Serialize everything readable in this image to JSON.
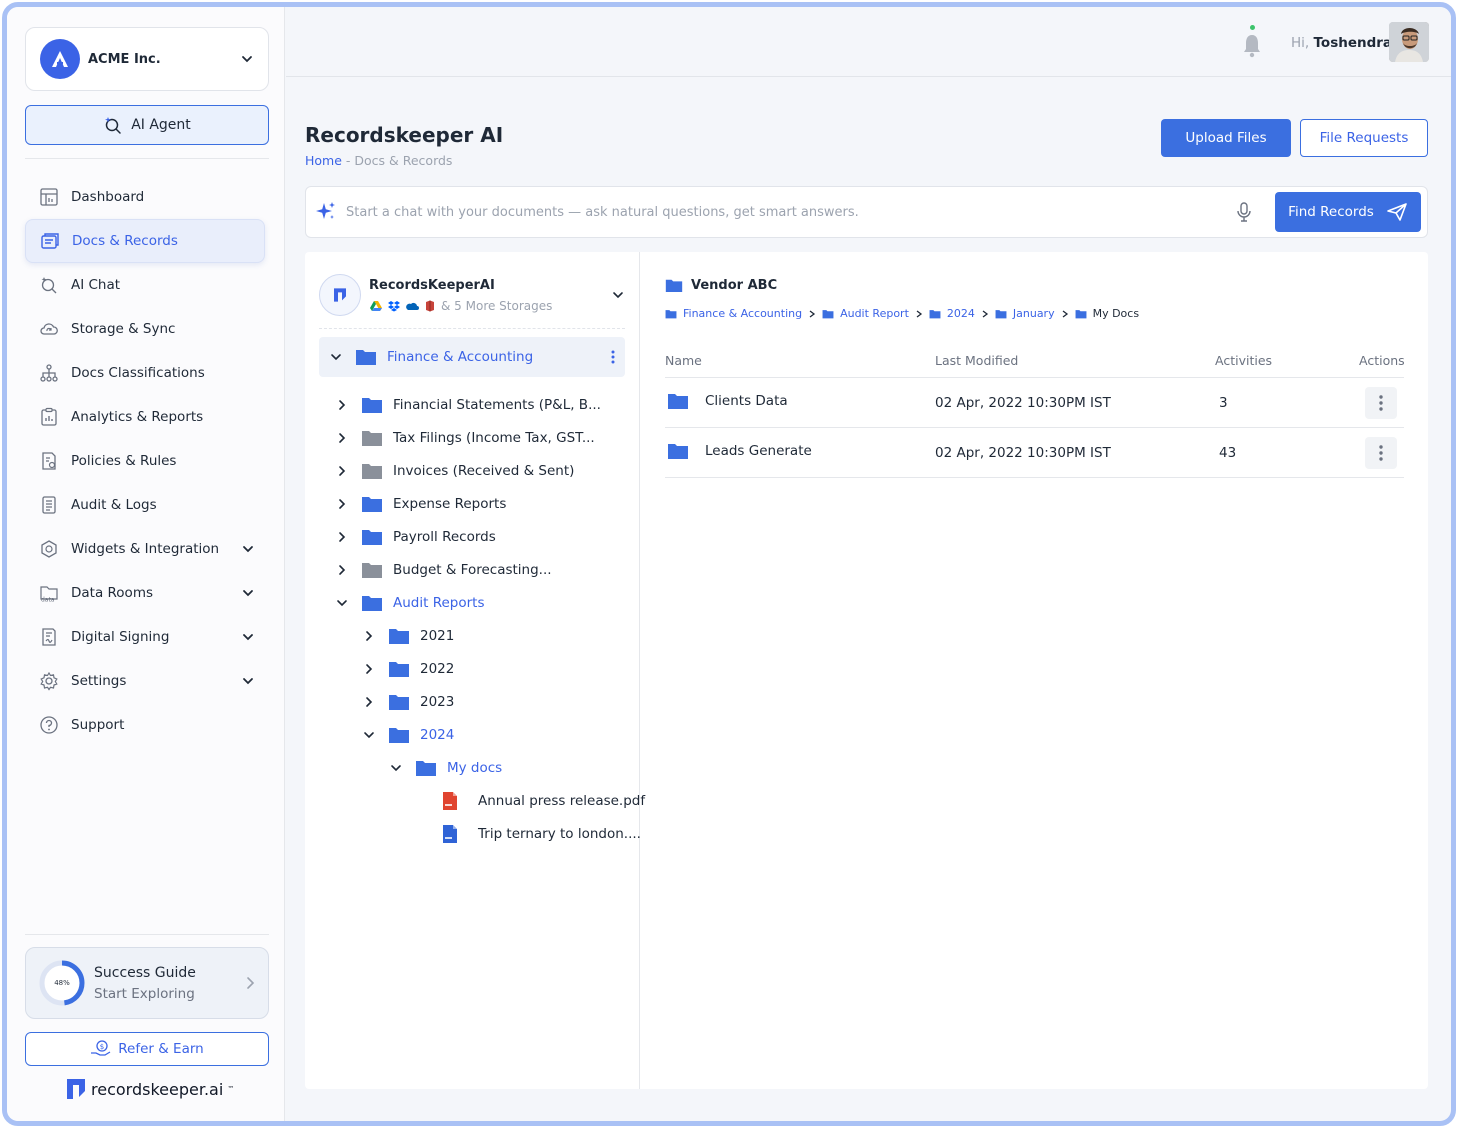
{
  "org": {
    "name": "ACME Inc.",
    "logo_letter": "A"
  },
  "ai_agent": {
    "label": "AI Agent"
  },
  "sidebar": {
    "items": [
      {
        "label": "Dashboard",
        "icon": "dashboard-icon",
        "expandable": false
      },
      {
        "label": "Docs & Records",
        "icon": "docs-icon",
        "expandable": false,
        "active": true
      },
      {
        "label": "AI Chat",
        "icon": "ai-chat-icon",
        "expandable": false
      },
      {
        "label": "Storage & Sync",
        "icon": "cloud-sync-icon",
        "expandable": false
      },
      {
        "label": "Docs Classifications",
        "icon": "hierarchy-icon",
        "expandable": false
      },
      {
        "label": "Analytics & Reports",
        "icon": "clipboard-chart-icon",
        "expandable": false
      },
      {
        "label": "Policies & Rules",
        "icon": "policy-icon",
        "expandable": false
      },
      {
        "label": "Audit & Logs",
        "icon": "log-icon",
        "expandable": false
      },
      {
        "label": "Widgets & Integration",
        "icon": "widgets-icon",
        "expandable": true
      },
      {
        "label": "Data Rooms",
        "icon": "data-folder-icon",
        "expandable": true
      },
      {
        "label": "Digital Signing",
        "icon": "signing-icon",
        "expandable": true
      },
      {
        "label": "Settings",
        "icon": "gear-icon",
        "expandable": true
      },
      {
        "label": "Support",
        "icon": "help-icon",
        "expandable": false
      }
    ]
  },
  "success_guide": {
    "title": "Success Guide",
    "subtitle": "Start Exploring",
    "progress_label": "48%",
    "progress": 0.48
  },
  "refer": {
    "label": "Refer & Earn"
  },
  "brand": {
    "name": "recordskeeper.ai",
    "mark": "™"
  },
  "topbar": {
    "greeting_prefix": "Hi,",
    "user_name": "Toshendra"
  },
  "page": {
    "title": "Recordskeeper AI",
    "breadcrumb_home": "Home",
    "breadcrumb_rest": " - Docs & Records",
    "upload_label": "Upload Files",
    "requests_label": "File Requests"
  },
  "chat": {
    "placeholder": "Start a chat with your documents — ask natural questions, get smart answers.",
    "find_label": "Find Records"
  },
  "storage": {
    "name": "RecordsKeeperAI",
    "more": "& 5 More Storages"
  },
  "tree": {
    "root": "Finance & Accounting",
    "rows": [
      {
        "label": "Financial Statements (P&L, B...",
        "level": 0,
        "state": "collapsed",
        "color": "#3b6fe0",
        "kind": "folder"
      },
      {
        "label": "Tax Filings (Income Tax, GST...",
        "level": 0,
        "state": "collapsed",
        "color": "#8a909a",
        "kind": "folder"
      },
      {
        "label": "Invoices (Received & Sent)",
        "level": 0,
        "state": "collapsed",
        "color": "#8a909a",
        "kind": "folder"
      },
      {
        "label": "Expense Reports",
        "level": 0,
        "state": "collapsed",
        "color": "#3b6fe0",
        "kind": "folder"
      },
      {
        "label": "Payroll Records",
        "level": 0,
        "state": "collapsed",
        "color": "#3b6fe0",
        "kind": "folder"
      },
      {
        "label": "Budget & Forecasting...",
        "level": 0,
        "state": "collapsed",
        "color": "#8a909a",
        "kind": "folder"
      },
      {
        "label": "Audit Reports",
        "level": 0,
        "state": "expanded",
        "color": "#3b6fe0",
        "kind": "folder",
        "selected": true
      },
      {
        "label": "2021",
        "level": 1,
        "state": "collapsed",
        "color": "#3b6fe0",
        "kind": "folder"
      },
      {
        "label": "2022",
        "level": 1,
        "state": "collapsed",
        "color": "#3b6fe0",
        "kind": "folder"
      },
      {
        "label": "2023",
        "level": 1,
        "state": "collapsed",
        "color": "#3b6fe0",
        "kind": "folder"
      },
      {
        "label": "2024",
        "level": 1,
        "state": "expanded",
        "color": "#3b6fe0",
        "kind": "folder",
        "selected": true
      },
      {
        "label": "My docs",
        "level": 2,
        "state": "expanded",
        "color": "#3b6fe0",
        "kind": "folder",
        "selected": true
      },
      {
        "label": "Annual press release.pdf",
        "level": 3,
        "kind": "pdf",
        "color": "#e0442f"
      },
      {
        "label": "Trip ternary to london....",
        "level": 3,
        "kind": "doc",
        "color": "#2f63d6"
      }
    ]
  },
  "files": {
    "vendor": "Vendor ABC",
    "path": [
      "Finance & Accounting",
      "Audit Report",
      "2024",
      "January",
      "My Docs"
    ],
    "columns": {
      "name": "Name",
      "modified": "Last Modified",
      "activities": "Activities",
      "actions": "Actions"
    },
    "rows": [
      {
        "name": "Clients Data",
        "modified": "02 Apr, 2022 10:30PM IST",
        "activities": "3"
      },
      {
        "name": "Leads Generate",
        "modified": "02 Apr, 2022 10:30PM IST",
        "activities": "43"
      }
    ]
  },
  "colors": {
    "accent": "#3b6fe0",
    "accent_text": "#3b63e6",
    "folder_grey": "#8a909a"
  }
}
